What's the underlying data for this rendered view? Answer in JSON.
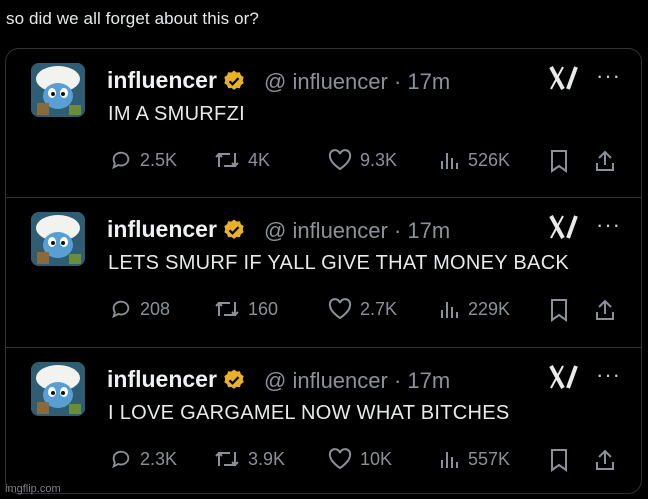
{
  "caption": "so did we all forget about this or?",
  "watermark": "imgflip.com",
  "colors": {
    "background": "#000000",
    "text": "#e7e9ea",
    "muted": "#8b9196",
    "verified": "#e8b12a",
    "border": "#2f3336"
  },
  "tweets": [
    {
      "display_name": "influencer",
      "handle": "@ influencer · 17m",
      "text": "IM A SMURFZI",
      "replies": "2.5K",
      "retweets": "4K",
      "likes": "9.3K",
      "views": "526K"
    },
    {
      "display_name": "influencer",
      "handle": "@ influencer · 17m",
      "text": "LETS SMURF IF YALL GIVE THAT MONEY BACK",
      "replies": "208",
      "retweets": "160",
      "likes": "2.7K",
      "views": "229K"
    },
    {
      "display_name": "influencer",
      "handle": "@ influencer · 17m",
      "text": "I LOVE  GARGAMEL  NOW WHAT BITCHES",
      "replies": "2.3K",
      "retweets": "3.9K",
      "likes": "10K",
      "views": "557K"
    }
  ],
  "icons": [
    "verified-badge-icon",
    "x-logo-icon",
    "more-icon",
    "reply-icon",
    "retweet-icon",
    "like-icon",
    "views-icon",
    "bookmark-icon",
    "share-icon"
  ]
}
